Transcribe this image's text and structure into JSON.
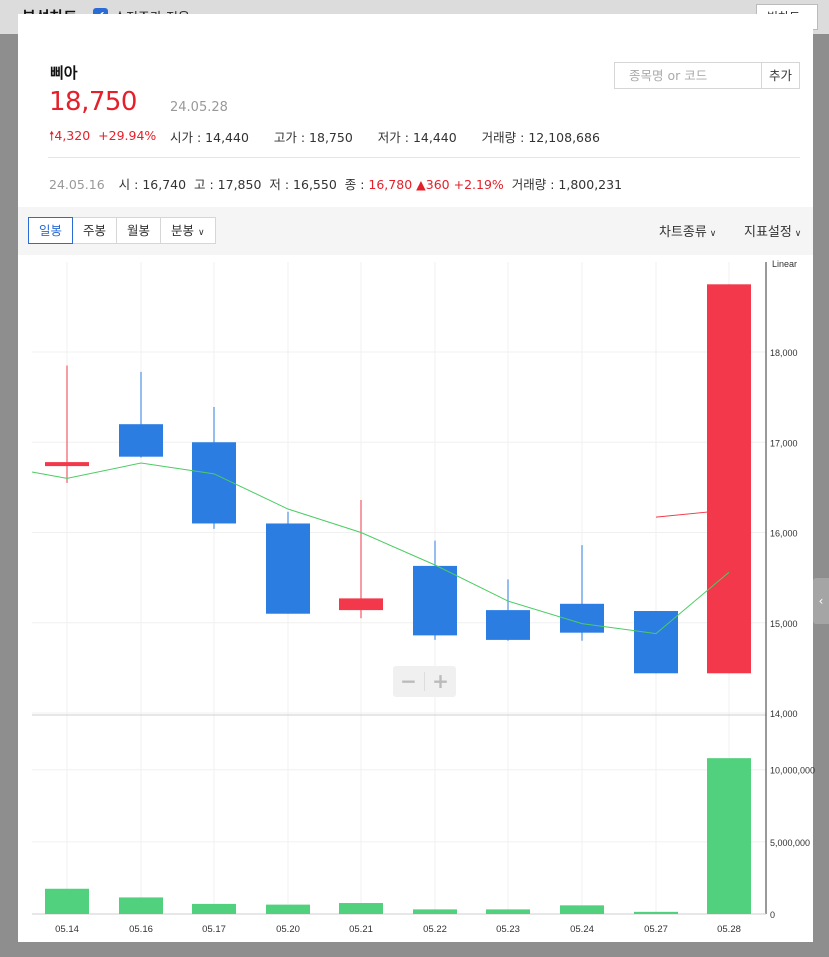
{
  "topbar": {
    "title": "분석차트",
    "adjust_label": "수정주가 적용",
    "adjust_checked": true,
    "big_chart": "빅차트"
  },
  "stock": {
    "name": "삐아",
    "price": "18,750",
    "date": "24.05.28",
    "change": "4,320",
    "change_pct": "+29.94%",
    "open": "시가 : 14,440",
    "high": "고가 : 18,750",
    "low": "저가 : 14,440",
    "volume": "거래량 : 12,108,686"
  },
  "search": {
    "placeholder": "종목명 or 코드",
    "add_label": "추가"
  },
  "prev_day": {
    "date": "24.05.16",
    "open": "시 : 16,740",
    "high": "고 : 17,850",
    "low": "저 : 16,550",
    "close_label": "종 : ",
    "close": "16,780",
    "change": "▲360",
    "change_pct": "+2.19%",
    "volume": "거래량 : 1,800,231"
  },
  "period_tabs": [
    {
      "label": "일봉",
      "active": true
    },
    {
      "label": "주봉",
      "active": false
    },
    {
      "label": "월봉",
      "active": false
    },
    {
      "label": "분봉",
      "active": false
    }
  ],
  "chart_type_label": "차트종류",
  "indicator_label": "지표설정",
  "colors": {
    "up": "#f2384a",
    "down": "#2b7de2",
    "volume": "#51d17d",
    "ma": "#4ccc63",
    "ma2": "#f2384a"
  },
  "chart_data": [
    {
      "type": "candlestick",
      "scale_label": "Linear",
      "categories": [
        "05.14",
        "05.16",
        "05.17",
        "05.20",
        "05.21",
        "05.22",
        "05.23",
        "05.24",
        "05.27",
        "05.28"
      ],
      "ylim": [
        14000,
        19000
      ],
      "ytick_values": [
        14000,
        15000,
        16000,
        17000,
        18000
      ],
      "ytick_labels": [
        "14,000",
        "15,000",
        "16,000",
        "17,000",
        "18,000"
      ],
      "candles": [
        {
          "open": 16750,
          "high": 17850,
          "low": 16550,
          "close": 16780,
          "dir": "up"
        },
        {
          "open": 17200,
          "high": 17780,
          "low": 16830,
          "close": 16840,
          "dir": "down"
        },
        {
          "open": 17000,
          "high": 17390,
          "low": 16040,
          "close": 16100,
          "dir": "down"
        },
        {
          "open": 16100,
          "high": 16230,
          "low": 15100,
          "close": 15100,
          "dir": "down"
        },
        {
          "open": 15140,
          "high": 16360,
          "low": 15050,
          "close": 15270,
          "dir": "up"
        },
        {
          "open": 15630,
          "high": 15910,
          "low": 14810,
          "close": 14860,
          "dir": "down"
        },
        {
          "open": 15140,
          "high": 15480,
          "low": 14800,
          "close": 14810,
          "dir": "down"
        },
        {
          "open": 15210,
          "high": 15860,
          "low": 14800,
          "close": 14890,
          "dir": "down"
        },
        {
          "open": 15130,
          "high": 15130,
          "low": 14440,
          "close": 14440,
          "dir": "down"
        },
        {
          "open": 14440,
          "high": 18750,
          "low": 14440,
          "close": 18750,
          "dir": "up"
        }
      ],
      "ma_short": [
        16600,
        16770,
        16650,
        16260,
        16000,
        15640,
        15240,
        14990,
        14880,
        15560
      ],
      "ma_long_from_index": 8,
      "ma_long": [
        16170,
        16250
      ]
    },
    {
      "type": "bar",
      "categories": [
        "05.14",
        "05.16",
        "05.17",
        "05.20",
        "05.21",
        "05.22",
        "05.23",
        "05.24",
        "05.27",
        "05.28"
      ],
      "values": [
        1750000,
        1150000,
        700000,
        650000,
        760000,
        320000,
        320000,
        600000,
        150000,
        10800000
      ],
      "ylim": [
        0,
        14000000
      ],
      "ytick_values": [
        0,
        5000000,
        10000000
      ],
      "ytick_labels": [
        "0",
        "5,000,000",
        "10,000,000"
      ]
    }
  ]
}
